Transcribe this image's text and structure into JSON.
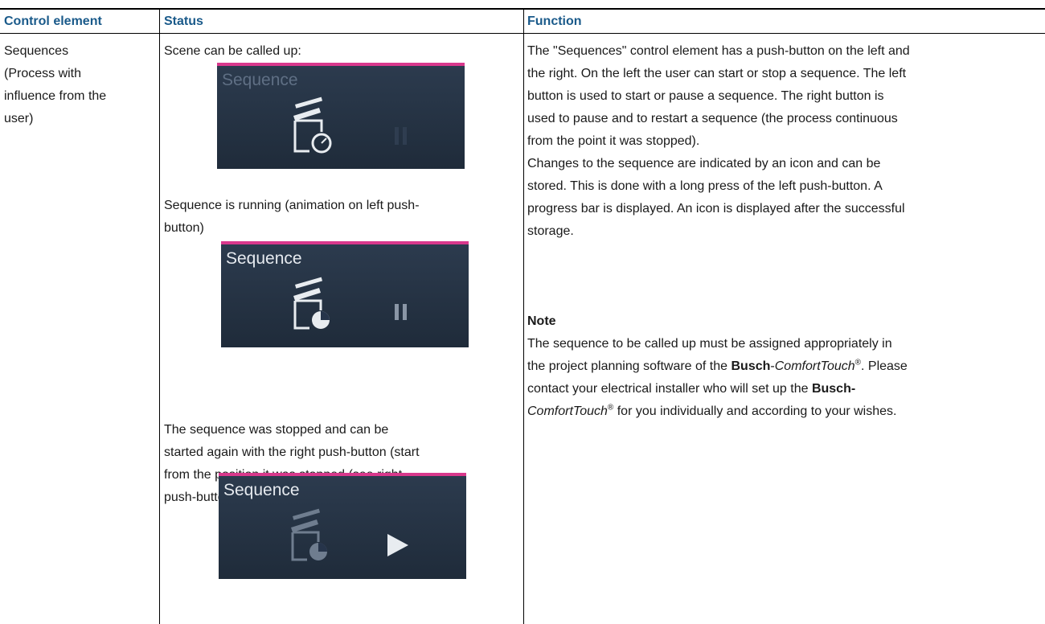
{
  "table": {
    "headers": {
      "control": "Control element",
      "status": "Status",
      "function": "Function"
    },
    "control_cell": [
      "Sequences",
      "(Process with",
      "influence from the",
      "user)"
    ],
    "status_items": [
      {
        "caption_lines": [
          "Scene can be called up:"
        ],
        "panel_title": "Sequence",
        "state": "callable"
      },
      {
        "caption_lines": [
          "Sequence is running (animation on left push-",
          "button)"
        ],
        "panel_title": "Sequence",
        "state": "running"
      },
      {
        "caption_lines": [
          "The sequence was stopped and can be",
          "started again with the right push-button (start",
          "from the position it was stopped (see right",
          "push-button))."
        ],
        "panel_title": "Sequence",
        "state": "stopped"
      }
    ],
    "function_lines": [
      "The \"Sequences\" control element has a push-button on the left and",
      "the right. On the left the user can start or stop a sequence. The left",
      "button is used to start or pause a sequence. The right button is",
      "used to pause and to restart a sequence (the process continuous",
      "from the point it was stopped).",
      "Changes to the sequence are indicated by an icon and can be",
      "stored. This is done with a long press of the left push-button. A",
      "progress bar is displayed. An icon is displayed after the successful",
      "storage."
    ],
    "note": {
      "heading": "Note",
      "line1": "The sequence to be called up must be assigned appropriately in",
      "line2_pre": "the project planning software of the ",
      "brand_bold": "Busch",
      "brand_dash": "-",
      "brand_italic": "ComfortTouch",
      "reg": "®",
      "line2_post": ". Please",
      "line3_pre": "contact your electrical installer who will set up the ",
      "line3_brand_bold": "Busch-",
      "line4_brand_italic": "ComfortTouch",
      "line4_post": " for you individually and according to your wishes."
    }
  },
  "colors": {
    "header": "#1a5a8a",
    "panel_accent": "#d9388c",
    "panel_bg": "#26344a"
  },
  "icons": [
    "clapperboard-clock-icon",
    "pause-icon",
    "play-icon"
  ]
}
